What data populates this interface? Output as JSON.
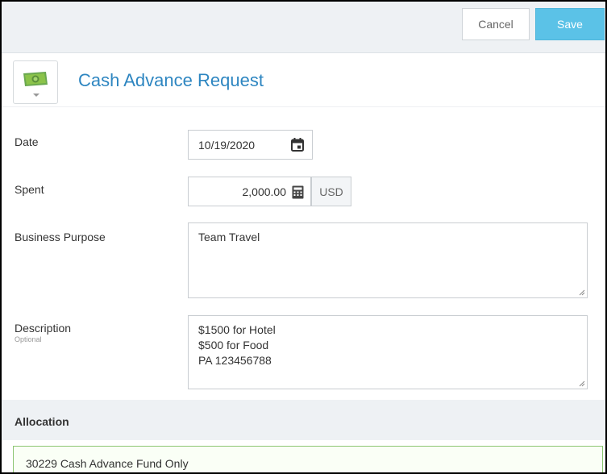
{
  "toolbar": {
    "cancel_label": "Cancel",
    "save_label": "Save",
    "save_color": "#5bc2e7"
  },
  "header": {
    "title": "Cash Advance Request",
    "type_icon": "money-bill-icon",
    "title_color": "#2e86c1"
  },
  "form": {
    "date": {
      "label": "Date",
      "value": "10/19/2020",
      "icon": "calendar-icon"
    },
    "spent": {
      "label": "Spent",
      "value": "2,000.00",
      "icon": "calculator-icon",
      "currency": "USD"
    },
    "business_purpose": {
      "label": "Business Purpose",
      "value": "Team Travel"
    },
    "description": {
      "label": "Description",
      "sublabel": "Optional",
      "lines": [
        "$1500 for Hotel",
        "$500 for Food",
        "PA 123456788"
      ]
    }
  },
  "allocation": {
    "title": "Allocation",
    "value": "30229 Cash Advance Fund Only"
  }
}
